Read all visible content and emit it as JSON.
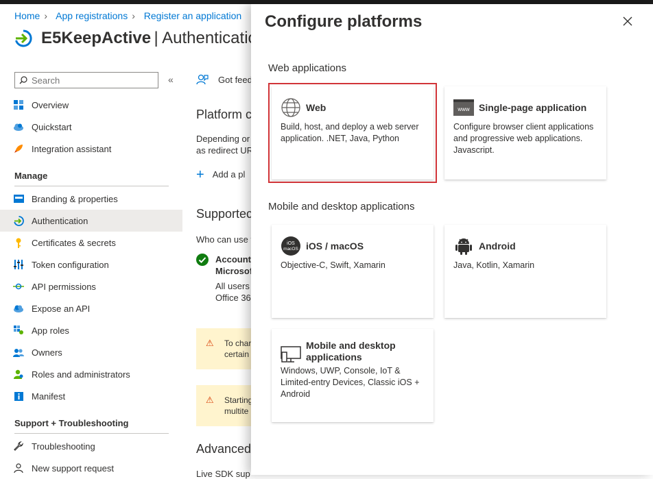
{
  "topbar": {
    "text": "..."
  },
  "breadcrumb": [
    "Home",
    "App registrations",
    "Register an application"
  ],
  "app": {
    "name": "E5KeepActive",
    "section": "| Authenticatio"
  },
  "search": {
    "placeholder": "Search"
  },
  "sidebar": {
    "items": [
      {
        "label": "Overview",
        "icon": "grid-icon"
      },
      {
        "label": "Quickstart",
        "icon": "cloud-icon"
      },
      {
        "label": "Integration assistant",
        "icon": "rocket-icon"
      }
    ],
    "manage_heading": "Manage",
    "manage_items": [
      {
        "label": "Branding & properties",
        "icon": "branding-icon"
      },
      {
        "label": "Authentication",
        "icon": "auth-icon",
        "active": true
      },
      {
        "label": "Certificates & secrets",
        "icon": "key-icon"
      },
      {
        "label": "Token configuration",
        "icon": "token-icon"
      },
      {
        "label": "API permissions",
        "icon": "api-icon"
      },
      {
        "label": "Expose an API",
        "icon": "cloud-api-icon"
      },
      {
        "label": "App roles",
        "icon": "app-roles-icon"
      },
      {
        "label": "Owners",
        "icon": "owners-icon"
      },
      {
        "label": "Roles and administrators",
        "icon": "roles-icon"
      },
      {
        "label": "Manifest",
        "icon": "manifest-icon"
      }
    ],
    "support_heading": "Support + Troubleshooting",
    "support_items": [
      {
        "label": "Troubleshooting",
        "icon": "wrench-icon"
      },
      {
        "label": "New support request",
        "icon": "person-icon"
      }
    ]
  },
  "main": {
    "feedback": "Got feed",
    "platform_heading": "Platform c",
    "platform_desc_1": "Depending or",
    "platform_desc_2": "as redirect UR",
    "add_platform": "Add a pl",
    "supported_heading": "Supportec",
    "who_can_use": "Who can use t",
    "accounts_1": "Accounts",
    "accounts_2": "Microsoft",
    "all_users": "All users",
    "office": "Office 36",
    "warn1_1": "To char",
    "warn1_2": "certain",
    "warn2_1": "Starting",
    "warn2_2": "multite",
    "advanced_heading": "Advanced",
    "live_sdk": "Live SDK sup"
  },
  "panel": {
    "title": "Configure platforms",
    "web_group": "Web applications",
    "mobile_group": "Mobile and desktop applications",
    "cards": {
      "web": {
        "title": "Web",
        "desc": "Build, host, and deploy a web server application. .NET, Java, Python"
      },
      "spa": {
        "title": "Single-page application",
        "desc": "Configure browser client applications and progressive web applications. Javascript."
      },
      "ios": {
        "title": "iOS / macOS",
        "desc": "Objective-C, Swift, Xamarin",
        "badge_1": "iOS",
        "badge_2": "macOS"
      },
      "android": {
        "title": "Android",
        "desc": "Java, Kotlin, Xamarin"
      },
      "desktop": {
        "title": "Mobile and desktop applications",
        "desc": "Windows, UWP, Console, IoT & Limited-entry Devices, Classic iOS + Android"
      }
    },
    "spa_badge": "www"
  },
  "colors": {
    "accent": "#0078d4",
    "selected_outline": "#d13438",
    "warning": "#d83b01"
  }
}
